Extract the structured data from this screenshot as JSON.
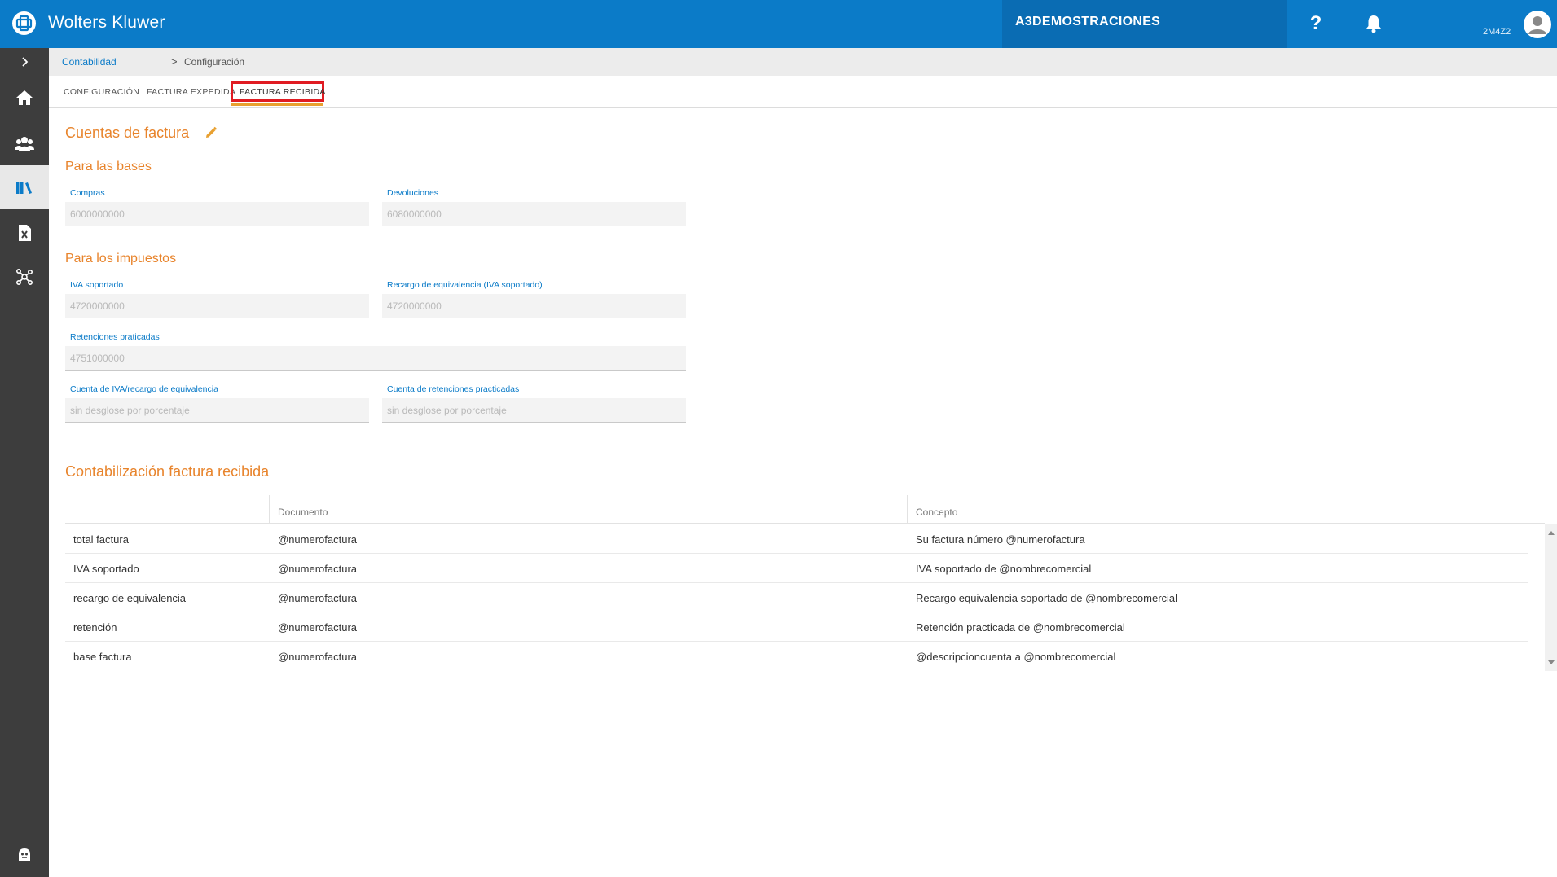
{
  "header": {
    "brand": "Wolters Kluwer",
    "company": "A3DEMOSTRACIONES",
    "user_code": "2M4Z2",
    "help_label": "?"
  },
  "breadcrumb": {
    "parent": "Contabilidad",
    "separator": ">",
    "current": "Configuración"
  },
  "tabs": [
    {
      "label": "CONFIGURACIÓN",
      "active": false
    },
    {
      "label": "FACTURA EXPEDIDA",
      "active": false
    },
    {
      "label": "FACTURA RECIBIDA",
      "active": true
    }
  ],
  "cuentas": {
    "title": "Cuentas de factura",
    "bases": {
      "title": "Para las bases",
      "compras_label": "Compras",
      "compras_value": "6000000000",
      "devoluciones_label": "Devoluciones",
      "devoluciones_value": "6080000000"
    },
    "impuestos": {
      "title": "Para los impuestos",
      "iva_label": "IVA soportado",
      "iva_value": "4720000000",
      "recargo_label": "Recargo de equivalencia (IVA soportado)",
      "recargo_value": "4720000000",
      "retenciones_label": "Retenciones praticadas",
      "retenciones_value": "4751000000",
      "cuenta_iva_label": "Cuenta de IVA/recargo de equivalencia",
      "cuenta_iva_value": "sin desglose por porcentaje",
      "cuenta_ret_label": "Cuenta de retenciones practicadas",
      "cuenta_ret_value": "sin desglose por porcentaje"
    }
  },
  "contabilizacion": {
    "title": "Contabilización factura recibida",
    "columns": [
      "",
      "Documento",
      "Concepto"
    ],
    "rows": [
      {
        "tipo": "total factura",
        "documento": "@numerofactura",
        "concepto": "Su factura número @numerofactura"
      },
      {
        "tipo": "IVA soportado",
        "documento": "@numerofactura",
        "concepto": "IVA soportado de @nombrecomercial"
      },
      {
        "tipo": "recargo de equivalencia",
        "documento": "@numerofactura",
        "concepto": "Recargo equivalencia soportado de @nombrecomercial"
      },
      {
        "tipo": "retención",
        "documento": "@numerofactura",
        "concepto": "Retención practicada de @nombrecomercial"
      },
      {
        "tipo": "base factura",
        "documento": "@numerofactura",
        "concepto": "@descripcioncuenta a @nombrecomercial"
      }
    ]
  },
  "colors": {
    "brand_blue": "#0b7bc8",
    "accent_orange": "#e8842c",
    "highlight_red": "#e01b22"
  },
  "icons": {
    "nav": [
      "chevron-right-icon",
      "home-icon",
      "users-icon",
      "books-icon",
      "excel-icon",
      "network-icon",
      "support-icon"
    ]
  }
}
